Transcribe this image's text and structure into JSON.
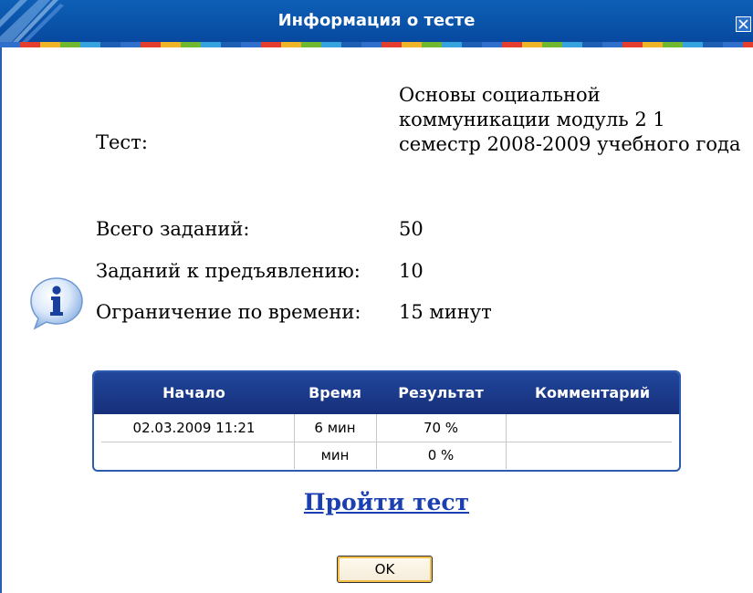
{
  "window": {
    "title": "Информация о тесте"
  },
  "info": {
    "test_label": "Тест:",
    "test_value": "Основы социальной коммуникации модуль 2 1 семестр 2008-2009 учебного года",
    "total_label": "Всего заданий:",
    "total_value": "50",
    "shown_label": "Заданий к предъявлению:",
    "shown_value": "10",
    "time_label": "Ограничение по времени:",
    "time_value": "15 минут"
  },
  "table": {
    "headers": [
      "Начало",
      "Время",
      "Результат",
      "Комментарий"
    ],
    "rows": [
      [
        "02.03.2009 11:21",
        "6 мин",
        "70 %",
        ""
      ],
      [
        "",
        "мин",
        "0 %",
        ""
      ]
    ]
  },
  "actions": {
    "take_test": "Пройти тест",
    "ok": "OK"
  },
  "icons": {
    "info": "info-icon",
    "close": "close-icon"
  },
  "colors": {
    "titlebar": "#0a55ab",
    "table_header": "#1e3e92",
    "link": "#1a3fb0"
  }
}
